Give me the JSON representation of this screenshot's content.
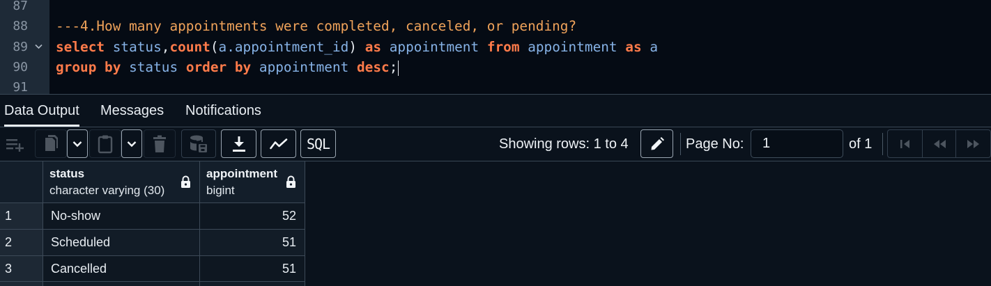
{
  "editor": {
    "lines": [
      {
        "num": "87",
        "foldable": false
      },
      {
        "num": "88",
        "foldable": false
      },
      {
        "num": "89",
        "foldable": true
      },
      {
        "num": "90",
        "foldable": false
      },
      {
        "num": "91",
        "foldable": false
      }
    ],
    "comment": "---4.How many appointments were completed, canceled, or pending?",
    "line89": {
      "select": "select",
      "status": " status",
      "comma": ",",
      "count": "count",
      "open": "(",
      "arg": "a.appointment_id",
      "close": ")",
      "as1": " as",
      "alias": " appointment",
      "from": " from",
      "table": " appointment",
      "as2": " as",
      "a": " a"
    },
    "line90": {
      "group_by": "group by",
      "status": " status",
      "order_by": " order by",
      "col": " appointment",
      "desc": " desc",
      "semi": ";"
    }
  },
  "tabs": [
    {
      "label": "Data Output",
      "active": true
    },
    {
      "label": "Messages",
      "active": false
    },
    {
      "label": "Notifications",
      "active": false
    }
  ],
  "toolbar": {
    "buttons": [
      {
        "icon": "add-row-icon",
        "enabled": false
      },
      {
        "icon": "copy-icon",
        "enabled": false
      },
      {
        "icon": "chevron-down-icon",
        "enabled": true
      },
      {
        "icon": "paste-icon",
        "enabled": false
      },
      {
        "icon": "chevron-down-icon",
        "enabled": true
      },
      {
        "icon": "delete-icon",
        "enabled": false
      },
      {
        "icon": "save-data-icon",
        "enabled": false
      },
      {
        "icon": "download-icon",
        "enabled": true
      },
      {
        "icon": "graph-icon",
        "enabled": true
      },
      {
        "icon": "sql-icon",
        "enabled": true,
        "label": "SQL"
      }
    ],
    "rows_label": "Showing rows: 1 to 4",
    "page_label": "Page No:",
    "page_value": "1",
    "of_label": "of 1"
  },
  "result": {
    "columns": [
      {
        "name": "status",
        "type": "character varying (30)",
        "locked": true
      },
      {
        "name": "appointment",
        "type": "bigint",
        "locked": true
      }
    ],
    "rows": [
      {
        "num": "1",
        "status": "No-show",
        "appointment": "52"
      },
      {
        "num": "2",
        "status": "Scheduled",
        "appointment": "51"
      },
      {
        "num": "3",
        "status": "Cancelled",
        "appointment": "51"
      }
    ]
  }
}
